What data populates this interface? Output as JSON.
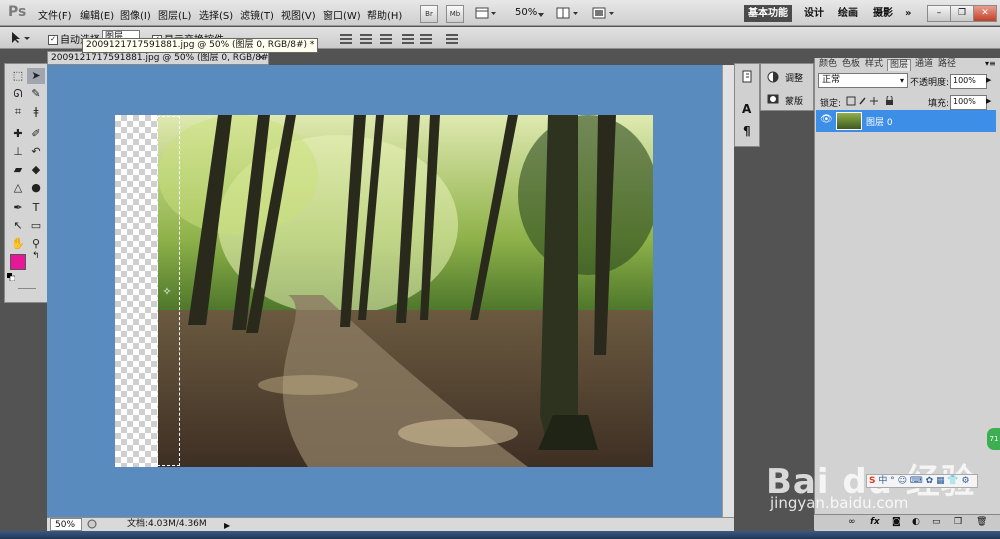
{
  "app": {
    "logo": "Ps"
  },
  "menu": [
    "文件(F)",
    "编辑(E)",
    "图像(I)",
    "图层(L)",
    "选择(S)",
    "滤镜(T)",
    "视图(V)",
    "窗口(W)",
    "帮助(H)"
  ],
  "menubar_buttons": {
    "bridge": "Br",
    "mini_bridge": "Mb",
    "zoom": "50%"
  },
  "workspaces": [
    "基本功能",
    "设计",
    "绘画",
    "摄影"
  ],
  "workspace_more": "»",
  "options": {
    "auto_select_label": "自动选择:",
    "auto_select_value": "图层",
    "show_transform_label": "显示变换控件"
  },
  "tooltip": "2009121717591881.jpg @ 50% (图层 0, RGB/8#) *",
  "doc_tab": {
    "title": "2009121717591881.jpg @ 50% (图层 0, RGB/8#) *",
    "close": "×"
  },
  "status": {
    "zoom": "50%",
    "doc_info": "文档:4.03M/4.36M"
  },
  "adjust_panel": {
    "adjust_label": "调整",
    "mask_label": "蒙版"
  },
  "panel_tabs": [
    "颜色",
    "色板",
    "样式",
    "图层",
    "通道",
    "路径"
  ],
  "layers": {
    "blend_mode": "正常",
    "opacity_label": "不透明度:",
    "opacity": "100%",
    "lock_label": "锁定:",
    "fill_label": "填充:",
    "fill": "100%",
    "items": [
      {
        "name": "图层 0"
      }
    ]
  },
  "colors": {
    "foreground": "#e8179a",
    "background": "#000000",
    "canvas_bg": "#5a8bbf",
    "layer_selected": "#3d8ee6"
  },
  "watermark": {
    "brand": "Bai du 经验",
    "url": "jingyan.baidu.com"
  }
}
